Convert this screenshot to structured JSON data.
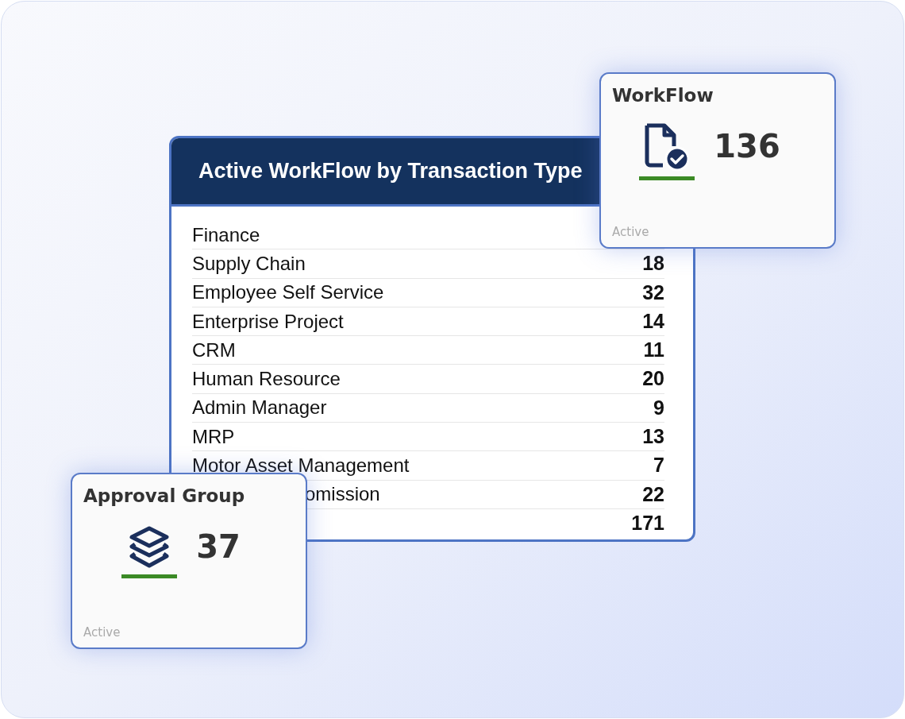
{
  "table": {
    "title": "Active WorkFlow by Transaction Type",
    "rows": [
      {
        "kind": "label_only",
        "label": "Finance"
      },
      {
        "kind": "row",
        "label": "Supply Chain",
        "value": "18"
      },
      {
        "kind": "row",
        "label": "Employee Self Service",
        "value": "32"
      },
      {
        "kind": "row",
        "label": "Enterprise Project",
        "value": "14"
      },
      {
        "kind": "row",
        "label": "CRM",
        "value": "11"
      },
      {
        "kind": "row",
        "label": "Human Resource",
        "value": "20"
      },
      {
        "kind": "row",
        "label": "Admin Manager",
        "value": "9"
      },
      {
        "kind": "row",
        "label": "MRP",
        "value": "13"
      },
      {
        "kind": "row",
        "label": "Motor Asset Management",
        "value": "7"
      },
      {
        "kind": "covered",
        "label": "omission",
        "value": "22"
      },
      {
        "kind": "total",
        "value": "171"
      }
    ]
  },
  "cards": [
    {
      "kind": "document",
      "title": "WorkFlow",
      "value": "136",
      "status": "Active"
    },
    {
      "kind": "layers",
      "title": "Approval Group",
      "value": "37",
      "status": "Active"
    }
  ]
}
